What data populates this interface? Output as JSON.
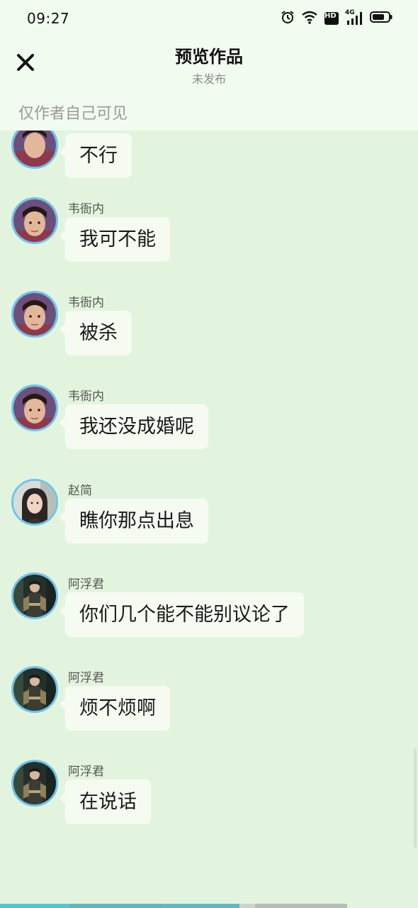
{
  "status_bar": {
    "time": "09:27",
    "hd_label": "HD",
    "network_label": "4G"
  },
  "header": {
    "title": "预览作品",
    "subtitle": "未发布",
    "visibility_note": "仅作者自己可见"
  },
  "messages": [
    {
      "sender": "",
      "text": "不行",
      "avatar": "man-portrait"
    },
    {
      "sender": "韦衙内",
      "text": "我可不能",
      "avatar": "man-portrait"
    },
    {
      "sender": "韦衙内",
      "text": "被杀",
      "avatar": "man-portrait"
    },
    {
      "sender": "韦衙内",
      "text": "我还没成婚呢",
      "avatar": "man-portrait"
    },
    {
      "sender": "赵简",
      "text": "瞧你那点出息",
      "avatar": "woman-portrait"
    },
    {
      "sender": "阿浮君",
      "text": "你们几个能不能别议论了",
      "avatar": "warrior-portrait"
    },
    {
      "sender": "阿浮君",
      "text": "烦不烦啊",
      "avatar": "warrior-portrait"
    },
    {
      "sender": "阿浮君",
      "text": "在说话",
      "avatar": "warrior-portrait"
    }
  ],
  "colors": {
    "chat_background": "#e3f4de",
    "header_background": "#f1fbef",
    "bubble": "#f6fbf2",
    "avatar_ring": "#6cc4ef",
    "progress_accent": "#4fc7d6"
  }
}
